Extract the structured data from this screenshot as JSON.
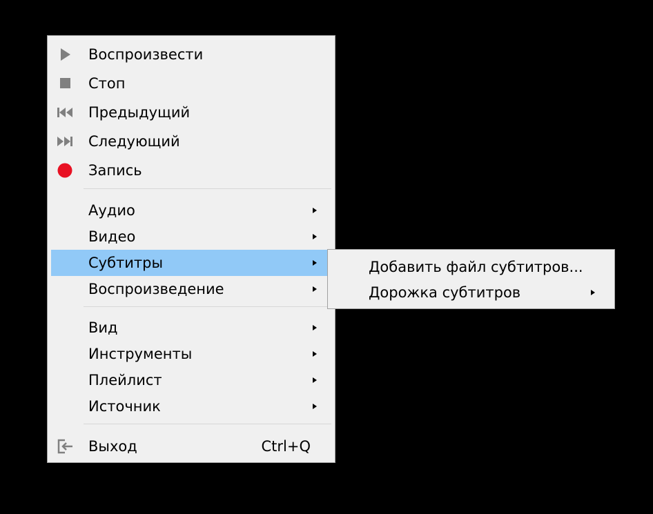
{
  "context_menu": {
    "items": [
      {
        "label": "Воспроизвести",
        "icon": "play-icon"
      },
      {
        "label": "Стоп",
        "icon": "stop-icon"
      },
      {
        "label": "Предыдущий",
        "icon": "previous-icon"
      },
      {
        "label": "Следующий",
        "icon": "next-icon"
      },
      {
        "label": "Запись",
        "icon": "record-icon"
      },
      {
        "label": "Аудио",
        "submenu": true
      },
      {
        "label": "Видео",
        "submenu": true
      },
      {
        "label": "Субтитры",
        "submenu": true,
        "highlighted": true
      },
      {
        "label": "Воспроизведение",
        "submenu": true
      },
      {
        "label": "Вид",
        "submenu": true
      },
      {
        "label": "Инструменты",
        "submenu": true
      },
      {
        "label": "Плейлист",
        "submenu": true
      },
      {
        "label": "Источник",
        "submenu": true
      },
      {
        "label": "Выход",
        "icon": "exit-icon",
        "shortcut": "Ctrl+Q"
      }
    ]
  },
  "subtitles_submenu": {
    "items": [
      {
        "label": "Добавить файл субтитров..."
      },
      {
        "label": "Дорожка субтитров",
        "submenu": true
      }
    ]
  },
  "colors": {
    "menu_background": "#f0f0f0",
    "highlight": "#91c9f7",
    "record": "#e81123",
    "icon_gray": "#808080"
  }
}
